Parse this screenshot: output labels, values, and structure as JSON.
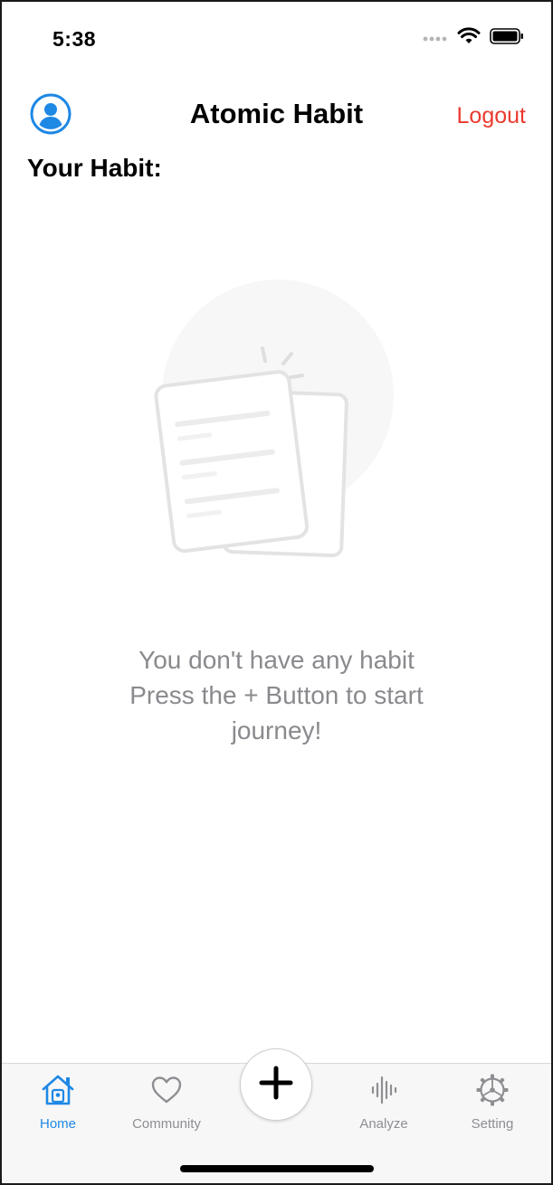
{
  "status_bar": {
    "time": "5:38",
    "icons": [
      "cellular-dots-icon",
      "wifi-icon",
      "battery-icon"
    ]
  },
  "nav": {
    "title": "Atomic Habit",
    "logout_label": "Logout",
    "avatar_icon": "person-circle-icon"
  },
  "section": {
    "title": "Your Habit:"
  },
  "empty_state": {
    "icon": "documents-illustration",
    "line1": "You don't have any habit",
    "line2": "Press the + Button to start",
    "line3": "journey!"
  },
  "tab_bar": {
    "items": [
      {
        "label": "Home",
        "icon": "home-icon",
        "active": true
      },
      {
        "label": "Community",
        "icon": "heart-icon",
        "active": false
      },
      {
        "label": "Analyze",
        "icon": "waveform-icon",
        "active": false
      },
      {
        "label": "Setting",
        "icon": "gear-icon",
        "active": false
      }
    ],
    "add_icon": "plus-icon"
  },
  "colors": {
    "accent": "#1e88e5",
    "logout": "#ea3a2f",
    "muted_text": "#8a8a8e",
    "tab_inactive": "#8e8e93"
  }
}
